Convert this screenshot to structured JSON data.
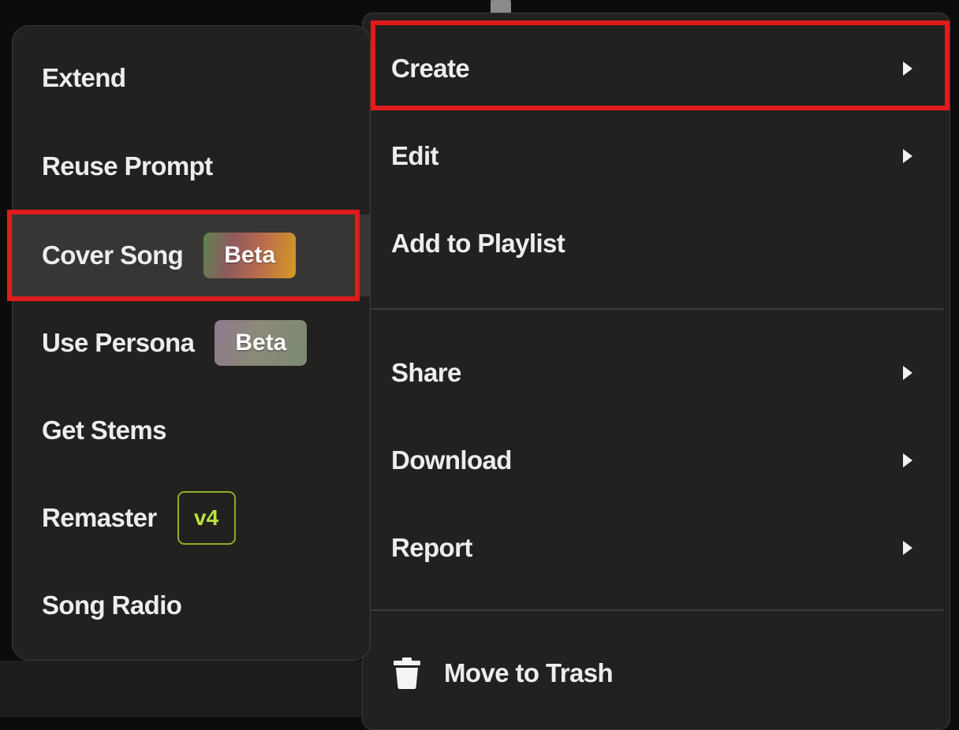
{
  "main_menu": {
    "items": [
      {
        "label": "Create",
        "has_submenu": true
      },
      {
        "label": "Edit",
        "has_submenu": true
      },
      {
        "label": "Add to Playlist",
        "has_submenu": false
      },
      {
        "label": "Share",
        "has_submenu": true
      },
      {
        "label": "Download",
        "has_submenu": true
      },
      {
        "label": "Report",
        "has_submenu": true
      }
    ],
    "trash_label": "Move to Trash",
    "trash_icon": "trash-icon"
  },
  "submenu": {
    "items": [
      {
        "label": "Extend"
      },
      {
        "label": "Reuse Prompt"
      },
      {
        "label": "Cover Song",
        "badge": "Beta"
      },
      {
        "label": "Use Persona",
        "badge": "Beta"
      },
      {
        "label": "Get Stems"
      },
      {
        "label": "Remaster",
        "badge": "v4"
      },
      {
        "label": "Song Radio"
      }
    ]
  },
  "colors": {
    "highlight": "#e01b1b",
    "menu_bg": "#232120",
    "v4_accent": "#b9e33a"
  }
}
